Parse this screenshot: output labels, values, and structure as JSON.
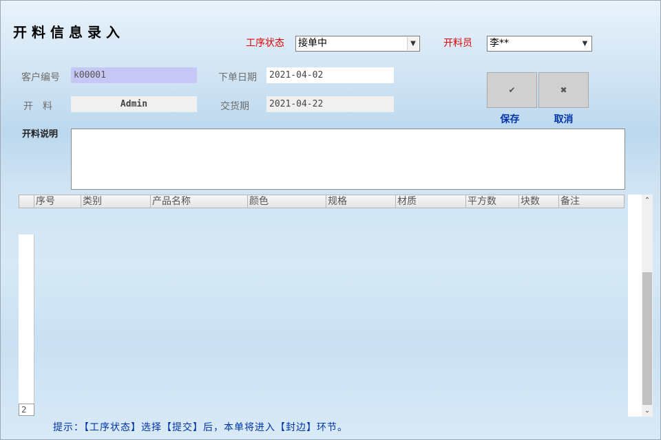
{
  "title": "开料信息录入",
  "process_status": {
    "label": "工序状态",
    "value": "接单中"
  },
  "operator": {
    "label": "开料员",
    "value": "李**"
  },
  "customer_id": {
    "label": "客户编号",
    "value": "k00001"
  },
  "order_date": {
    "label": "下单日期",
    "value": "2021-04-02"
  },
  "cutter": {
    "label": "开　料",
    "value": "Admin"
  },
  "delivery_date": {
    "label": "交货期",
    "value": "2021-04-22"
  },
  "buttons": {
    "save_icon": "✔",
    "save_label": "保存",
    "cancel_icon": "✖",
    "cancel_label": "取消"
  },
  "notes": {
    "label": "开料说明",
    "value": ""
  },
  "grid": {
    "columns": [
      "序号",
      "类别",
      "产品名称",
      "颜色",
      "规格",
      "材质",
      "平方数",
      "块数",
      "备注"
    ],
    "row_number": "2"
  },
  "scrollbar": {
    "up_icon": "⌃",
    "down_icon": "⌄"
  },
  "hint": "提示：【工序状态】选择【提交】后，本单将进入【封边】环节。"
}
